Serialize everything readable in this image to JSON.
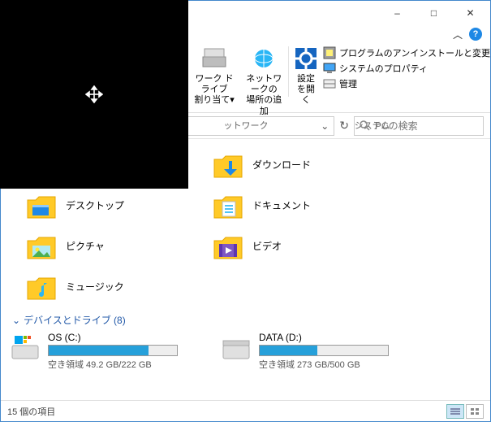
{
  "titlebar": {
    "minimize": "–",
    "maximize": "□",
    "close": "✕"
  },
  "ribbon": {
    "left_group_label": "ットワーク",
    "items": {
      "network_drive": "ワーク ドライブ\n割り当て▾",
      "add_location": "ネットワークの\n場所の追加",
      "open_settings": "設定\nを開く"
    },
    "system": {
      "uninstall": "プログラムのアンインストールと変更",
      "properties": "システムのプロパティ",
      "manage": "管理",
      "label": "システム"
    }
  },
  "addressbar": {
    "refresh": "↻",
    "dropdown": "⌄",
    "search_placeholder": "PCの検索"
  },
  "folders": [
    {
      "name": "ダウンロード",
      "icon": "download"
    },
    {
      "name": "デスクトップ",
      "icon": "desktop"
    },
    {
      "name": "ドキュメント",
      "icon": "document"
    },
    {
      "name": "ピクチャ",
      "icon": "pictures"
    },
    {
      "name": "ビデオ",
      "icon": "video"
    },
    {
      "name": "ミュージック",
      "icon": "music"
    }
  ],
  "devices_header": "デバイスとドライブ (8)",
  "drives": [
    {
      "name": "OS (C:)",
      "free_text": "空き領域 49.2 GB/222 GB",
      "fill_pct": 78
    },
    {
      "name": "DATA (D:)",
      "free_text": "空き領域 273 GB/500 GB",
      "fill_pct": 45
    }
  ],
  "statusbar": {
    "items": "15 個の項目"
  }
}
